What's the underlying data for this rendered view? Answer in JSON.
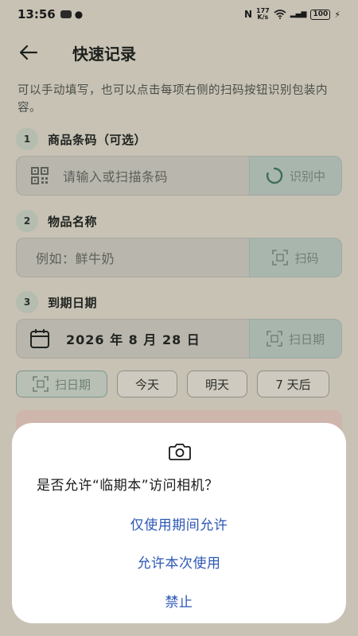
{
  "status_bar": {
    "time": "13:56",
    "speed_top": "177",
    "speed_bottom": "K/s",
    "battery": "100"
  },
  "header": {
    "title": "快速记录"
  },
  "intro": "可以手动填写，也可以点击每项右侧的扫码按钮识别包装内容。",
  "steps": [
    {
      "number": "1",
      "label": "商品条码（可选）",
      "placeholder": "请输入或扫描条码",
      "action": "识别中"
    },
    {
      "number": "2",
      "label": "物品名称",
      "placeholder": "例如：鲜牛奶",
      "action": "扫码"
    },
    {
      "number": "3",
      "label": "到期日期",
      "value": "2026 年 8 月 28 日",
      "action": "扫日期"
    }
  ],
  "chips": [
    "扫日期",
    "今天",
    "明天",
    "7 天后"
  ],
  "dialog": {
    "message": "是否允许“临期本”访问相机？",
    "allow_while_using": "仅使用期间允许",
    "allow_once": "允许本次使用",
    "deny": "禁止"
  },
  "colors": {
    "background": "#c8c2b5",
    "dialog_button": "#2d57b6",
    "action_button": "#a9b6ae"
  }
}
